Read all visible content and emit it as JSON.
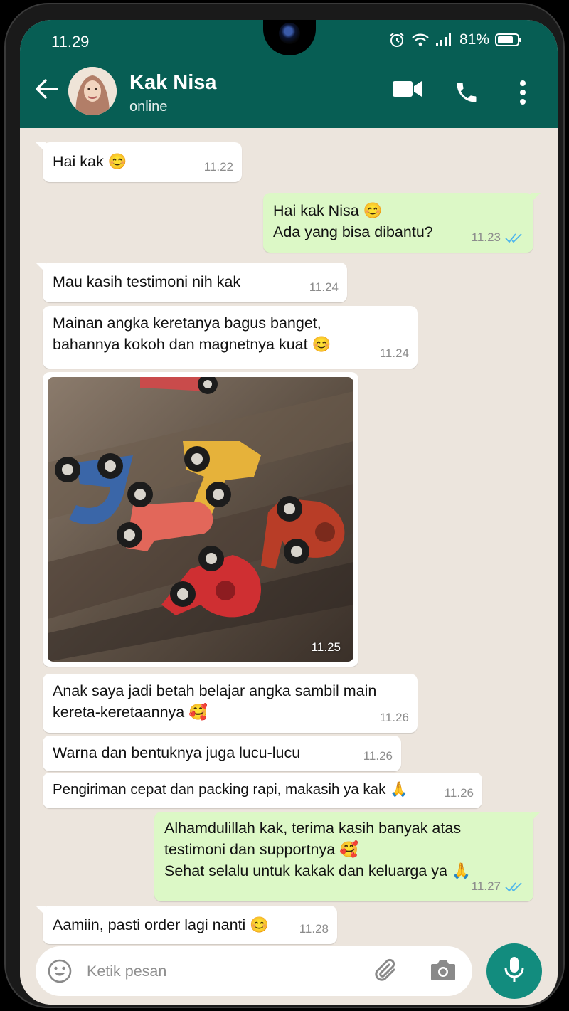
{
  "status_bar": {
    "time": "11.29",
    "battery": "81%"
  },
  "header": {
    "contact_name": "Kak Nisa",
    "contact_status": "online"
  },
  "messages": [
    {
      "text": "Hai kak 😊",
      "time": "11.22",
      "direction": "incoming"
    },
    {
      "text": "Hai kak Nisa 😊\nAda yang bisa dibantu?",
      "time": "11.23",
      "direction": "outgoing",
      "read": true
    },
    {
      "text": "Mau kasih testimoni nih kak",
      "time": "11.24",
      "direction": "incoming"
    },
    {
      "text": "Mainan angka keretanya bagus banget,\nbahannya kokoh dan magnetnya kuat 😊",
      "time": "11.24",
      "direction": "incoming"
    },
    {
      "text": "Anak saya jadi betah belajar angka sambil main\nkereta-keretaannya 🥰",
      "time": "11.26",
      "direction": "incoming"
    },
    {
      "text": "Warna dan bentuknya juga lucu-lucu",
      "time": "11.26",
      "direction": "incoming"
    },
    {
      "text": "Pengiriman cepat dan packing rapi, makasih ya kak 🙏",
      "time": "11.26",
      "direction": "incoming"
    },
    {
      "text": "Alhamdulillah kak, terima kasih banyak atas\ntestimoni dan supportnya 🥰\nSehat selalu untuk kakak dan keluarga ya 🙏",
      "time": "11.27",
      "direction": "outgoing",
      "read": true
    },
    {
      "text": "Aamiin, pasti order lagi nanti 😊",
      "time": "11.28",
      "direction": "incoming"
    }
  ],
  "photo_message": {
    "time": "11.25",
    "direction": "incoming"
  },
  "composer": {
    "placeholder": "Ketik pesan"
  },
  "icons": {
    "header": [
      "back-arrow-icon",
      "video-call-icon",
      "voice-call-icon",
      "more-vert-icon"
    ],
    "composer": [
      "emoji-icon",
      "attach-icon",
      "camera-icon",
      "mic-icon"
    ],
    "status": [
      "alarm-icon",
      "wifi-icon",
      "signal-icon",
      "battery-icon"
    ]
  },
  "colors": {
    "header": "#075e54",
    "incoming_bubble": "#ffffff",
    "outgoing_bubble": "#dcf8c6",
    "mic_button": "#128c7e",
    "read_ticks": "#4fb6ec"
  }
}
